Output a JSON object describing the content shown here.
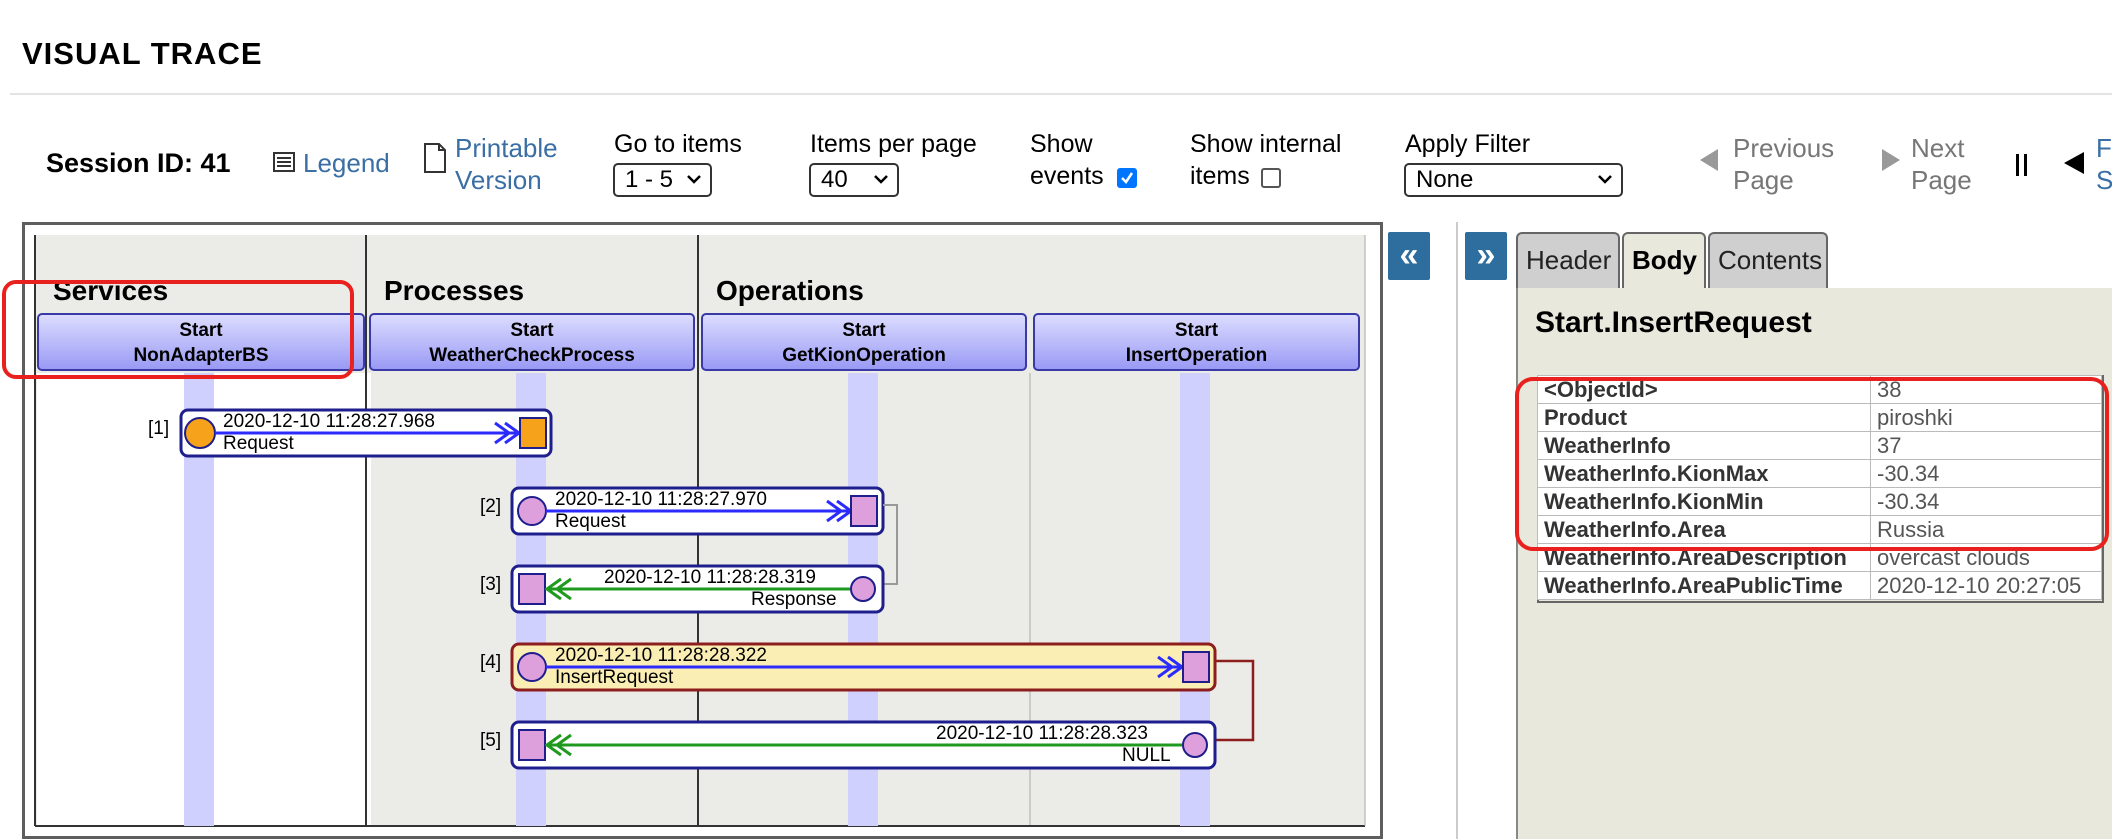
{
  "page": {
    "title": "VISUAL TRACE"
  },
  "toolbar": {
    "session_label": "Session ID: 41",
    "legend_label": "Legend",
    "printable_line1": "Printable",
    "printable_line2": "Version",
    "goto_label": "Go to items",
    "goto_value": "1 - 5",
    "perpage_label": "Items per page",
    "perpage_value": "40",
    "show_events_line1": "Show",
    "show_events_line2": "events",
    "show_events_checked": true,
    "show_internal_line1": "Show internal",
    "show_internal_line2": "items",
    "show_internal_checked": false,
    "filter_label": "Apply Filter",
    "filter_value": "None",
    "prev_line1": "Previous",
    "prev_line2": "Page",
    "next_line1": "Next",
    "next_line2": "Page",
    "pause_icon": "pause-icon",
    "cut_link_line1": "F",
    "cut_link_line2": "S"
  },
  "diagram": {
    "groups": [
      "Services",
      "Processes",
      "Operations"
    ],
    "actors": [
      {
        "line1": "Start",
        "line2": "NonAdapterBS"
      },
      {
        "line1": "Start",
        "line2": "WeatherCheckProcess"
      },
      {
        "line1": "Start",
        "line2": "GetKionOperation"
      },
      {
        "line1": "Start",
        "line2": "InsertOperation"
      }
    ],
    "messages": [
      {
        "index": "[1]",
        "time": "2020-12-10 11:28:27.968",
        "label": "Request"
      },
      {
        "index": "[2]",
        "time": "2020-12-10 11:28:27.970",
        "label": "Request"
      },
      {
        "index": "[3]",
        "time": "2020-12-10 11:28:28.319",
        "label": "Response"
      },
      {
        "index": "[4]",
        "time": "2020-12-10 11:28:28.322",
        "label": "InsertRequest"
      },
      {
        "index": "[5]",
        "time": "2020-12-10 11:28:28.323",
        "label": "NULL"
      }
    ]
  },
  "panel": {
    "collapse_left": "«",
    "collapse_right": "»",
    "tabs": [
      {
        "label": "Header",
        "active": false
      },
      {
        "label": "Body",
        "active": true
      },
      {
        "label": "Contents",
        "active": false
      }
    ],
    "title": "Start.InsertRequest",
    "properties": [
      {
        "key": "<ObjectId>",
        "value": "38"
      },
      {
        "key": "Product",
        "value": "piroshki"
      },
      {
        "key": "WeatherInfo",
        "value": "37"
      },
      {
        "key": "WeatherInfo.KionMax",
        "value": "-30.34"
      },
      {
        "key": "WeatherInfo.KionMin",
        "value": "-30.34"
      },
      {
        "key": "WeatherInfo.Area",
        "value": "Russia"
      },
      {
        "key": "WeatherInfo.AreaDescription",
        "value": "overcast clouds"
      },
      {
        "key": "WeatherInfo.AreaPublicTime",
        "value": "2020-12-10 20:27:05"
      }
    ]
  },
  "colors": {
    "highlight": "#e8211e",
    "link": "#3a6ea5",
    "request_arrow": "#2b2bff",
    "response_arrow": "#1f9a1f",
    "lifeline": "#d0d0ff"
  }
}
